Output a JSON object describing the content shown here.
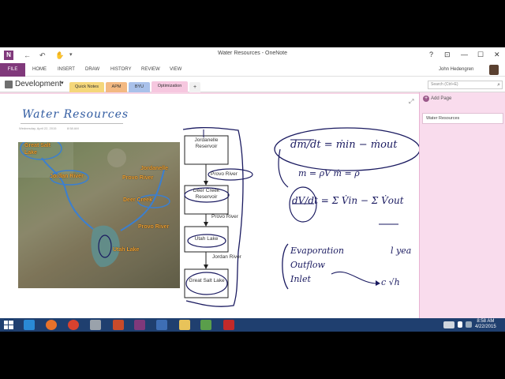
{
  "window": {
    "title": "Water Resources - OneNote",
    "app_icon": "N",
    "controls": {
      "help": "?",
      "restore_ribbon": "⊡",
      "minimize": "—",
      "maximize": "☐",
      "close": "✕"
    }
  },
  "quick_access": {
    "back": "←",
    "undo": "↶",
    "touch": "✋",
    "customize": "▾"
  },
  "ribbon": {
    "file_label": "FILE",
    "tabs": [
      "HOME",
      "INSERT",
      "DRAW",
      "HISTORY",
      "REVIEW",
      "VIEW"
    ],
    "user": "John Hedengren"
  },
  "notebook": {
    "name": "Development",
    "sections": [
      "Quick Notes",
      "APM",
      "BYU",
      "Optimization"
    ],
    "add_section": "+",
    "search_placeholder": "Search (Ctrl+E)"
  },
  "sidebar": {
    "add_page": "Add Page",
    "pages": [
      "Water Resources"
    ]
  },
  "note": {
    "title": "Water Resources",
    "date": "Wednesday, April 22, 2015",
    "time": "8:58 AM"
  },
  "map": {
    "labels": {
      "great_salt_lake": "Great Salt Lake",
      "jordan_river": "Jordan River",
      "jordanelle": "Jordanelle",
      "provo_river_top": "Provo River",
      "deer_creek": "Deer Creek",
      "provo_river_bottom": "Provo River",
      "utah_lake": "Utah Lake"
    }
  },
  "diagram": {
    "reservoirs": [
      "Jordanelle Reservoir",
      "Deer Creek Reservoir",
      "Utah Lake",
      "Great Salt Lake"
    ],
    "flows": [
      "Provo River",
      "Provo River",
      "Jordan River"
    ]
  },
  "equations": {
    "mass_balance": "dm/dt = ṁin − ṁout",
    "density": "m = ρV    ṁ = ρ",
    "volume_balance": "dV/dt = Σ V̇in − Σ V̇out",
    "notes": [
      "Evaporation",
      "Outflow",
      "Inlet"
    ],
    "year_note": "l yea",
    "inlet_formula": "c √h"
  },
  "taskbar": {
    "time": "8:58 AM",
    "date": "4/22/2015"
  },
  "colors": {
    "onenote_purple": "#80397b",
    "ink_blue": "#1a1a60",
    "map_blue": "#3b7fd0",
    "label_orange": "#f0a030"
  }
}
